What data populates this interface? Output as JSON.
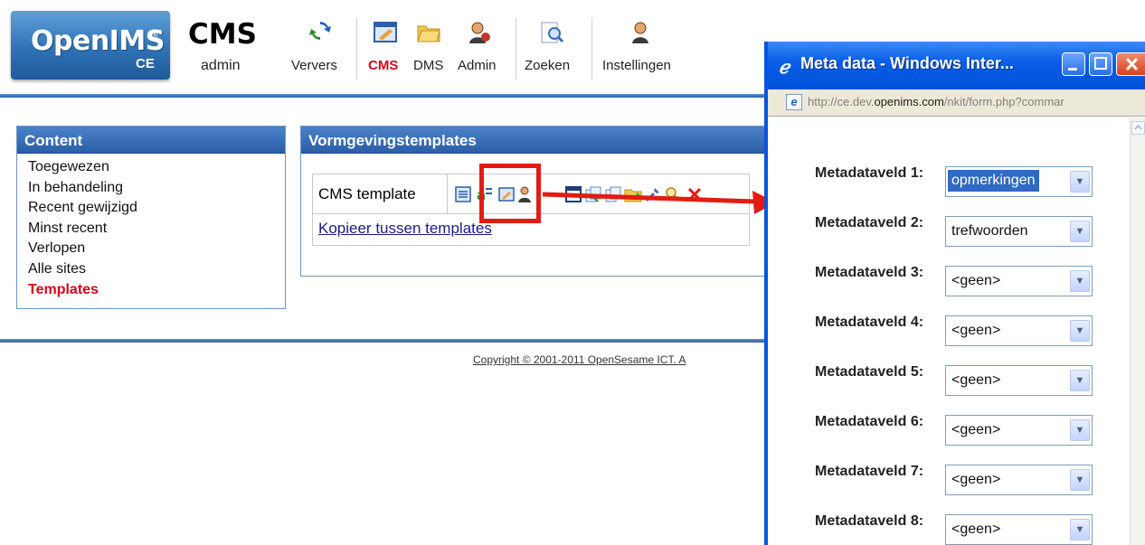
{
  "logo": {
    "name": "OpenIMS",
    "reg": "®",
    "edition": "CE"
  },
  "app": {
    "title": "CMS",
    "user": "admin"
  },
  "toolbar": {
    "items": [
      {
        "label": "Ververs",
        "icon": "refresh-icon"
      },
      {
        "label": "CMS",
        "icon": "cms-edit-icon",
        "active": true
      },
      {
        "label": "DMS",
        "icon": "folder-icon"
      },
      {
        "label": "Admin",
        "icon": "admin-user-icon"
      },
      {
        "label": "Zoeken",
        "icon": "search-document-icon"
      },
      {
        "label": "Instellingen",
        "icon": "settings-user-icon"
      }
    ]
  },
  "sidebar": {
    "title": "Content",
    "items": [
      {
        "label": "Toegewezen"
      },
      {
        "label": "In behandeling"
      },
      {
        "label": "Recent gewijzigd"
      },
      {
        "label": "Minst recent"
      },
      {
        "label": "Verlopen"
      },
      {
        "label": "Alle sites"
      },
      {
        "label": "Templates",
        "active": true
      }
    ]
  },
  "main": {
    "title": "Vormgevingstemplates",
    "template_name": "CMS template",
    "copy_link": "Kopieer tussen templates"
  },
  "footer": {
    "copyright": "Copyright © 2001-2011 OpenSesame ICT. A"
  },
  "popup": {
    "title": "Meta data - Windows Inter...",
    "url_prefix": "http://ce.dev.",
    "url_domain": "openims.com",
    "url_suffix": "/nkit/form.php?commar",
    "fields": [
      {
        "label": "Metadataveld 1:",
        "value": "opmerkingen",
        "selected": true
      },
      {
        "label": "Metadataveld 2:",
        "value": "trefwoorden"
      },
      {
        "label": "Metadataveld 3:",
        "value": "<geen>"
      },
      {
        "label": "Metadataveld 4:",
        "value": "<geen>"
      },
      {
        "label": "Metadataveld 5:",
        "value": "<geen>"
      },
      {
        "label": "Metadataveld 6:",
        "value": "<geen>"
      },
      {
        "label": "Metadataveld 7:",
        "value": "<geen>"
      },
      {
        "label": "Metadataveld 8:",
        "value": "<geen>"
      }
    ]
  },
  "colors": {
    "accent_red": "#d4061a",
    "header_blue": "#2e64a8",
    "xp_blue": "#0a5fe8"
  }
}
